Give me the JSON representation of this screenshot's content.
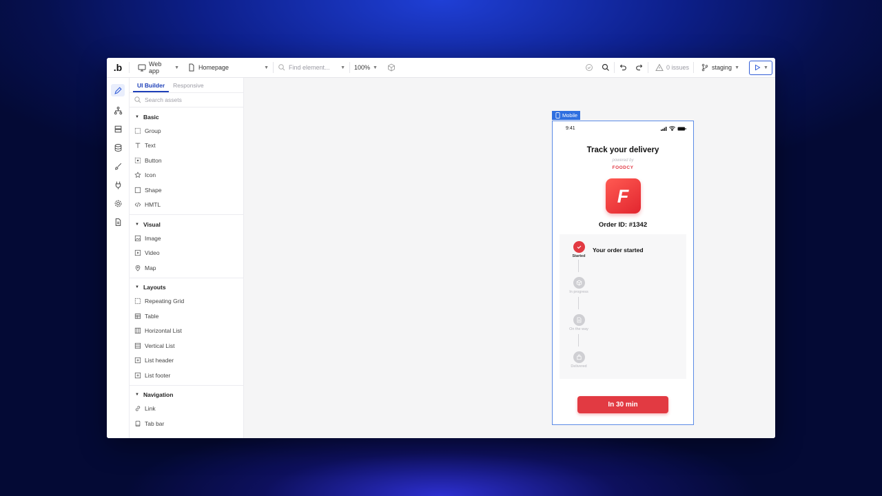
{
  "app": {
    "logo": ".b"
  },
  "toolbar": {
    "app_type": "Web app",
    "page": "Homepage",
    "find_placeholder": "Find element...",
    "zoom": "100%",
    "issues": "0 issues",
    "branch": "staging"
  },
  "panel": {
    "tabs": [
      "UI Builder",
      "Responsive"
    ],
    "search_placeholder": "Search assets",
    "sections": [
      {
        "title": "Basic",
        "items": [
          "Group",
          "Text",
          "Button",
          "Icon",
          "Shape",
          "HMTL"
        ]
      },
      {
        "title": "Visual",
        "items": [
          "Image",
          "Video",
          "Map"
        ]
      },
      {
        "title": "Layouts",
        "items": [
          "Repeating Grid",
          "Table",
          "Horizontal List",
          "Vertical List",
          "List header",
          "List footer"
        ]
      },
      {
        "title": "Navigation",
        "items": [
          "Link",
          "Tab bar"
        ]
      }
    ]
  },
  "canvas": {
    "device_label": "Mobile",
    "status_time": "9:41",
    "title": "Track your delivery",
    "powered_by": "powered by",
    "brand": "FOODCY",
    "app_icon_letter": "F",
    "order_id": "Order ID: #1342",
    "current_step_title": "Your order started",
    "steps": [
      "Started",
      "In progress",
      "On the way",
      "Delivered"
    ],
    "cta": "In 30 min"
  },
  "colors": {
    "accent": "#1d3fb8",
    "brand_red": "#e23a42",
    "selection_blue": "#2f6fe0"
  }
}
